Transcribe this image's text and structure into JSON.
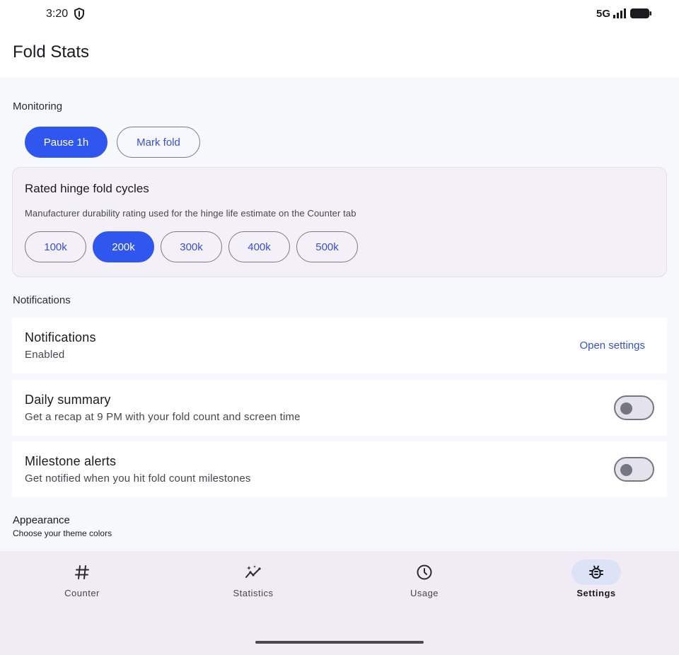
{
  "status_bar": {
    "time": "3:20",
    "network": "5G"
  },
  "app_bar": {
    "title": "Fold Stats"
  },
  "monitoring": {
    "label": "Monitoring",
    "pause_label": "Pause 1h",
    "mark_fold_label": "Mark fold"
  },
  "hinge_card": {
    "title": "Rated hinge fold cycles",
    "description": "Manufacturer durability rating used for the hinge life estimate on the Counter tab",
    "options": [
      "100k",
      "200k",
      "300k",
      "400k",
      "500k"
    ],
    "selected": "200k"
  },
  "notifications": {
    "section_label": "Notifications",
    "rows": [
      {
        "title": "Notifications",
        "subtitle": "Enabled",
        "action": "Open settings"
      },
      {
        "title": "Daily summary",
        "subtitle": "Get a recap at 9 PM with your fold count and screen time",
        "enabled": false
      },
      {
        "title": "Milestone alerts",
        "subtitle": "Get notified when you hit fold count milestones",
        "enabled": false
      }
    ]
  },
  "appearance": {
    "title": "Appearance",
    "subtitle": "Choose your theme colors"
  },
  "nav": {
    "items": [
      {
        "label": "Counter",
        "icon": "hash-icon"
      },
      {
        "label": "Statistics",
        "icon": "sparkle-chart-icon"
      },
      {
        "label": "Usage",
        "icon": "clock-icon"
      },
      {
        "label": "Settings",
        "icon": "bug-settings-icon"
      }
    ],
    "active": "Settings"
  },
  "colors": {
    "accent": "#3056f0",
    "link": "#3550d8",
    "background": "#f7f8fc",
    "nav_background": "#f1ecf4",
    "nav_active_pill": "#dde3f7"
  }
}
